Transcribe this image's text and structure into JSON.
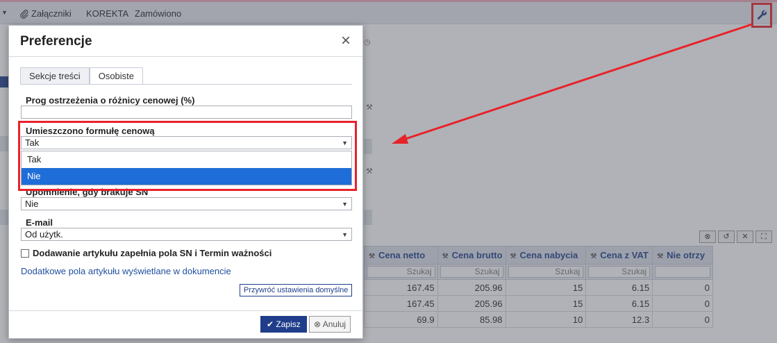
{
  "toolbar": {
    "attachments_label": "Załączniki",
    "korekta_label": "KOREKTA",
    "zamowiono_label": "Zamówiono"
  },
  "modal": {
    "title": "Preferencje",
    "tabs": [
      {
        "label": "Sekcje treści",
        "active": false
      },
      {
        "label": "Osobiste",
        "active": true
      }
    ],
    "fields": {
      "price_diff_label": "Prog ostrzeżenia o różnicy cenowej (%)",
      "price_diff_value": "",
      "formula_label": "Umieszczono formułę cenową",
      "formula_value": "Tak",
      "formula_options": [
        "Tak",
        "Nie"
      ],
      "formula_highlighted_option": "Nie",
      "sn_label": "Upomnienie, gdy brakuje SN",
      "sn_value": "Nie",
      "email_label": "E-mail",
      "email_value": "Od użytk."
    },
    "checkbox_label": "Dodawanie artykułu zapełnia pola SN i Termin ważności",
    "checkbox_checked": false,
    "link_text": "Dodatkowe pola artykułu wyświetlane w dokumencie",
    "restore_label": "Przywróć ustawienia domyślne",
    "save_label": "Zapisz",
    "cancel_label": "Anuluj"
  },
  "table": {
    "columns": [
      "Cena netto",
      "Cena brutto",
      "Cena nabycia",
      "Cena z VAT",
      "Nie otrzy"
    ],
    "search_placeholder": "Szukaj",
    "rows": [
      [
        "167.45",
        "205.96",
        "15",
        "6.15",
        "0"
      ],
      [
        "167.45",
        "205.96",
        "15",
        "6.15",
        "0"
      ],
      [
        "69.9",
        "85.98",
        "10",
        "12.3",
        "0"
      ]
    ]
  },
  "colors": {
    "accent": "#1f3d8a",
    "annotation": "#e8222a",
    "selected_option": "#1f6dd8"
  }
}
